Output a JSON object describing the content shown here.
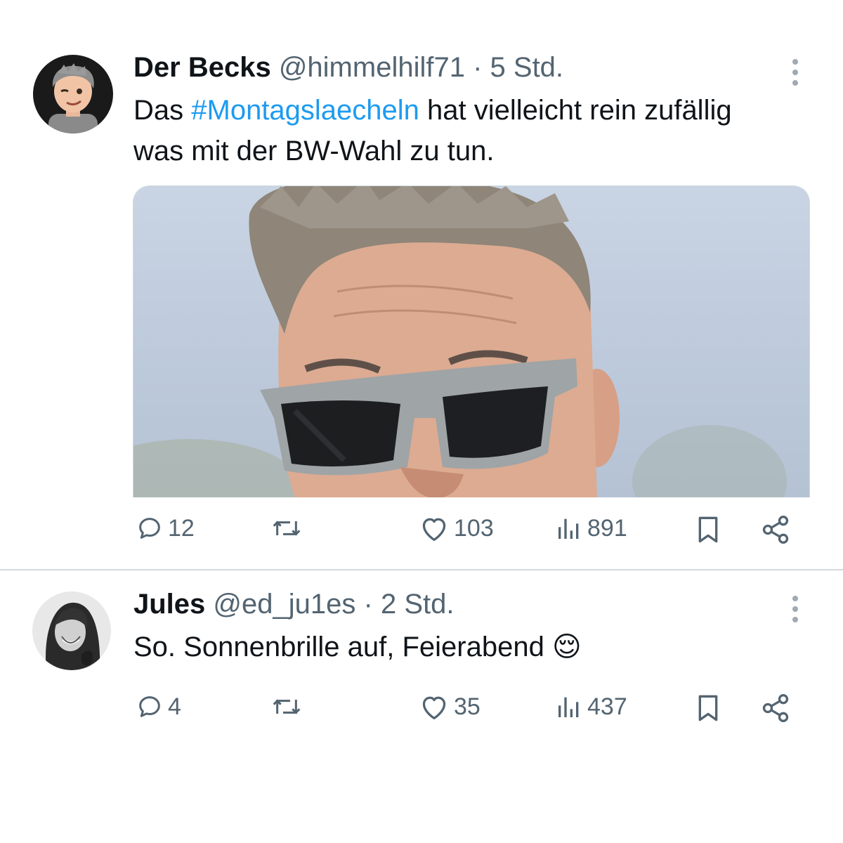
{
  "tweets": [
    {
      "name": "Der Becks",
      "handle": "@himmelhilf71",
      "separator": "·",
      "time": "5 Std.",
      "text_before": "Das ",
      "hashtag": "#Montagslaecheln",
      "text_after": " hat vielleicht rein zufällig was mit der BW-Wahl zu tun.",
      "replies": "12",
      "retweets": "",
      "likes": "103",
      "views": "891"
    },
    {
      "name": "Jules",
      "handle": "@ed_ju1es",
      "separator": "·",
      "time": "2 Std.",
      "text": "So. Sonnenbrille auf, Feierabend",
      "emoji": "😌",
      "replies": "4",
      "retweets": "",
      "likes": "35",
      "views": "437"
    }
  ],
  "icons": {
    "reply": "reply-icon",
    "retweet": "retweet-icon",
    "like": "heart-icon",
    "views": "views-icon",
    "bookmark": "bookmark-icon",
    "share": "share-icon",
    "more": "more-icon"
  },
  "colors": {
    "hashtag": "#1d9bf0",
    "secondary_text": "#536471",
    "divider": "#d4d9dd"
  }
}
